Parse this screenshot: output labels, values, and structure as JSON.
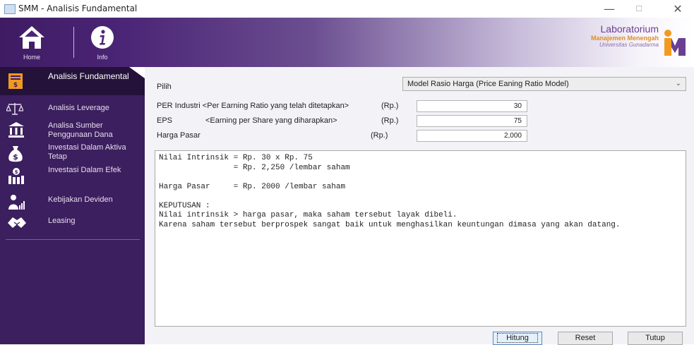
{
  "window": {
    "title": "SMM - Analisis Fundamental",
    "minimize_glyph": "—",
    "maximize_glyph": "☐",
    "close_glyph": "✕"
  },
  "header": {
    "home_label": "Home",
    "info_label": "Info",
    "logo": {
      "line1": "Laboratorium",
      "line2": "Manajemen Menengah",
      "line3": "Universitas Gunadarma",
      "mark": "M"
    }
  },
  "sidebar": {
    "items": [
      {
        "label": "Analisis Fundamental",
        "icon": "dollar-document-icon",
        "active": true
      },
      {
        "label": "Analisis Leverage",
        "icon": "scale-icon"
      },
      {
        "label": "Analisa Sumber Penggunaan Dana",
        "icon": "bank-icon"
      },
      {
        "label": "Investasi Dalam Aktiva Tetap",
        "icon": "money-bag-icon"
      },
      {
        "label": "Investasi Dalam Efek",
        "icon": "stock-building-icon"
      },
      {
        "label": "Kebijakan Deviden",
        "icon": "person-chart-icon"
      },
      {
        "label": "Leasing",
        "icon": "handshake-icon"
      }
    ]
  },
  "form": {
    "pilih_label": "Pilih",
    "model_selected": "Model Rasio Harga (Price Eaning Ratio Model)",
    "per_label": "PER Industri <Per Earning Ratio yang telah ditetapkan>",
    "per_unit": "(Rp.)",
    "per_value": "30",
    "eps_label": "EPS",
    "eps_desc": "<Earning per Share yang diharapkan>",
    "eps_unit": "(Rp.)",
    "eps_value": "75",
    "harga_label": "Harga Pasar",
    "harga_unit": "(Rp.)",
    "harga_value": "2,000"
  },
  "result_text": "Nilai Intrinsik = Rp. 30 x Rp. 75\n                = Rp. 2,250 /lembar saham\n\nHarga Pasar     = Rp. 2000 /lembar saham\n\nKEPUTUSAN :\nNilai intrinsik > harga pasar, maka saham tersebut layak dibeli.\nKarena saham tersebut berprospek sangat baik untuk menghasilkan keuntungan dimasa yang akan datang.",
  "buttons": {
    "hitung": "Hitung",
    "reset": "Reset",
    "tutup": "Tutup"
  },
  "colors": {
    "sidebar_bg": "#3c1f5e",
    "sidebar_active": "#24123a",
    "accent_orange": "#f29a1f",
    "accent_purple": "#6a3f93"
  }
}
